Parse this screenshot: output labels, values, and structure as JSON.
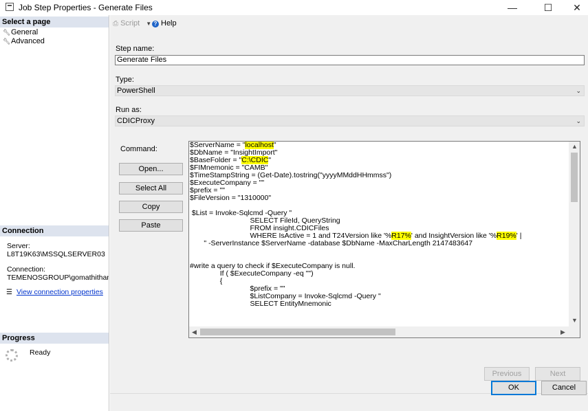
{
  "window": {
    "title": "Job Step Properties - Generate Files",
    "minimize": "—",
    "maximize": "☐",
    "close": "✕"
  },
  "sidebar": {
    "select_page_header": "Select a page",
    "pages": [
      {
        "label": "General",
        "icon": "wrench-icon"
      },
      {
        "label": "Advanced",
        "icon": "wrench-icon"
      }
    ],
    "connection_header": "Connection",
    "server_label": "Server:",
    "server_value": "L8T19K63\\MSSQLSERVER03",
    "connection_label": "Connection:",
    "connection_value": "TEMENOSGROUP\\gomathithanga",
    "view_connection_link": "View connection properties",
    "progress_header": "Progress",
    "progress_status": "Ready"
  },
  "toolbar": {
    "script_label": "Script",
    "help_label": "Help"
  },
  "form": {
    "step_name_label": "Step name:",
    "step_name_value": "Generate Files",
    "type_label": "Type:",
    "type_value": "PowerShell",
    "run_as_label": "Run as:",
    "run_as_value": "CDICProxy",
    "command_label": "Command:",
    "open_button": "Open...",
    "select_all_button": "Select All",
    "copy_button": "Copy",
    "paste_button": "Paste"
  },
  "command_lines": [
    [
      "$ServerName = \"",
      {
        "hl": "localhost"
      },
      "\""
    ],
    [
      "$DbName = \"InsightImport\""
    ],
    [
      "$BaseFolder = \"",
      {
        "hl": "C:\\CDIC"
      },
      "\""
    ],
    [
      "$FIMnemonic = \"CAMB\""
    ],
    [
      "$TimeStampString = (Get-Date).tostring(\"yyyyMMddHHmmss\")"
    ],
    [
      "$ExecuteCompany = \"\""
    ],
    [
      "$prefix = \"\""
    ],
    [
      "$FileVersion = \"1310000\""
    ],
    [
      ""
    ],
    [
      " $List = Invoke-Sqlcmd -Query \""
    ],
    [
      "                              SELECT FileId, QueryString"
    ],
    [
      "                              FROM insight.CDICFiles"
    ],
    [
      "                              WHERE IsActive = 1 and T24Version like '%",
      {
        "hl": "R17%"
      },
      "' and InsightVersion like '%",
      {
        "hl": "R19%"
      },
      "' |"
    ],
    [
      "       \" -ServerInstance $ServerName -database $DbName -MaxCharLength 2147483647"
    ],
    [
      ""
    ],
    [
      ""
    ],
    [
      "#write a query to check if $ExecuteCompany is null."
    ],
    [
      "               If ( $ExecuteCompany -eq \"\")"
    ],
    [
      "               {"
    ],
    [
      "                              $prefix = \"\""
    ],
    [
      "                              $ListCompany = Invoke-Sqlcmd -Query \""
    ],
    [
      "                              SELECT EntityMnemonic"
    ]
  ],
  "wizard": {
    "previous_button": "Previous",
    "next_button": "Next"
  },
  "dialog": {
    "ok_button": "OK",
    "cancel_button": "Cancel"
  }
}
